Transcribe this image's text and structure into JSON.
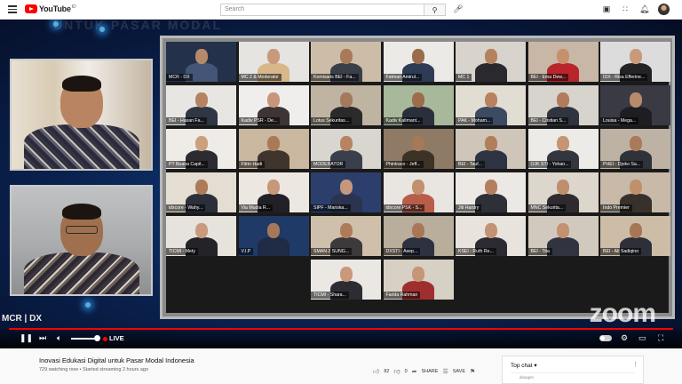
{
  "header": {
    "logo_text": "YouTube",
    "logo_sup": "ID",
    "search_placeholder": "Search",
    "icons": [
      "menu-icon",
      "search-icon",
      "mic-icon",
      "create-video-icon",
      "apps-icon",
      "notifications-icon",
      "account-avatar"
    ]
  },
  "player": {
    "background_title": "UNTUK PASAR MODAL",
    "speakers": [
      {
        "name": "speaker-top"
      },
      {
        "name": "speaker-bottom"
      }
    ],
    "participants": [
      {
        "label": "MCR - DX",
        "bg": "#23314a",
        "skin": "#b48a6a",
        "cloth": "#445577",
        "active": true
      },
      {
        "label": "MC 2 & Moderator",
        "bg": "#e6e4e0",
        "skin": "#c79a7c",
        "cloth": "#d8b88a",
        "active": false
      },
      {
        "label": "Komisaris BEI - Fa...",
        "bg": "#cdbca8",
        "skin": "#a97a5a",
        "cloth": "#3b3f4a",
        "active": false
      },
      {
        "label": "Fatman Amirul...",
        "bg": "#eceae6",
        "skin": "#9a6c4a",
        "cloth": "#2d3b55",
        "active": false
      },
      {
        "label": "MC 1",
        "bg": "#d8d3cc",
        "skin": "#b3825f",
        "cloth": "#2a2a2e",
        "active": false
      },
      {
        "label": "BEI - Ema Dew...",
        "bg": "#c8b7a6",
        "skin": "#c6906c",
        "cloth": "#b8252b",
        "active": false
      },
      {
        "label": "IDX - Risa Efferine...",
        "bg": "#dcdcdc",
        "skin": "#c99a7a",
        "cloth": "#222227",
        "active": false
      },
      {
        "label": "BEI - Hasan Fa...",
        "bg": "#e8e6e2",
        "skin": "#b48462",
        "cloth": "#2f3644",
        "active": false
      },
      {
        "label": "Kadiv PSR - De...",
        "bg": "#f0eeec",
        "skin": "#c7967a",
        "cloth": "#3d3434",
        "active": false
      },
      {
        "label": "Lotus Sekuritas...",
        "bg": "#bfb3a2",
        "skin": "#a47a5c",
        "cloth": "#2a2a2a",
        "active": false
      },
      {
        "label": "Kadiv Kalimant...",
        "bg": "#a8b89a",
        "skin": "#9c6c4c",
        "cloth": "#2b2f3c",
        "active": false
      },
      {
        "label": "PAK - Moham...",
        "bg": "#e2ddd2",
        "skin": "#b8825e",
        "cloth": "#3c4a62",
        "active": false
      },
      {
        "label": "BEI - Cristian S...",
        "bg": "#d7d4ce",
        "skin": "#b07c5c",
        "cloth": "#30343e",
        "active": false
      },
      {
        "label": "Louisa - Mega...",
        "bg": "#3a3a44",
        "skin": "#b88a6c",
        "cloth": "#1e1e22",
        "active": false
      },
      {
        "label": "PT Buana Capit...",
        "bg": "#efece8",
        "skin": "#caa07e",
        "cloth": "#2c2c30",
        "active": false
      },
      {
        "label": "Fitrin Hadi",
        "bg": "#c9b7a0",
        "skin": "#a97a58",
        "cloth": "#40352c",
        "active": false
      },
      {
        "label": "MODERATOR",
        "bg": "#d9d6d0",
        "skin": "#b68462",
        "cloth": "#3a3f4c",
        "active": false
      },
      {
        "label": "Phintraco - Jeff...",
        "bg": "#8f7a66",
        "skin": "#a77858",
        "cloth": "#3c3226",
        "active": false
      },
      {
        "label": "BEI - Tauf...",
        "bg": "#cfc5b8",
        "skin": "#b17e5c",
        "cloth": "#2d3342",
        "active": false
      },
      {
        "label": "OJK STI - Yohan...",
        "bg": "#ecebe8",
        "skin": "#c59574",
        "cloth": "#33363e",
        "active": false
      },
      {
        "label": "PHEI - Djoko Sa...",
        "bg": "#bdb2a4",
        "skin": "#a97b5b",
        "cloth": "#30323a",
        "active": false
      },
      {
        "label": "idxcore - Wahy...",
        "bg": "#e4ddd2",
        "skin": "#ad7b59",
        "cloth": "#2a2f3a",
        "active": false
      },
      {
        "label": "Via Mudia R...",
        "bg": "#ede7e2",
        "skin": "#c7977a",
        "cloth": "#202026",
        "active": false
      },
      {
        "label": "SIPF - Mariska...",
        "bg": "#2c3f6c",
        "skin": "#c5987c",
        "cloth": "#2b3350",
        "active": false
      },
      {
        "label": "idxcore PSK - S...",
        "bg": "#e9e6e1",
        "skin": "#c3906f",
        "cloth": "#b95d4b",
        "active": false
      },
      {
        "label": "Jiti Hardry",
        "bg": "#ece9e4",
        "skin": "#b47f5e",
        "cloth": "#2e3038",
        "active": false
      },
      {
        "label": "MNC Sekurita...",
        "bg": "#dcd6cc",
        "skin": "#bf8f6d",
        "cloth": "#2e2b30",
        "active": false
      },
      {
        "label": "Indo Premier",
        "bg": "#c8b9a8",
        "skin": "#c0906c",
        "cloth": "#37312c",
        "active": false
      },
      {
        "label": "TICMI - Mety",
        "bg": "#e6e2dc",
        "skin": "#c89a7e",
        "cloth": "#242428",
        "active": false
      },
      {
        "label": "V.I.P",
        "bg": "#1f3a66",
        "skin": "#a67858",
        "cloth": "#1f2a44",
        "active": false
      },
      {
        "label": "SMAN 2 SUNG...",
        "bg": "#cfc0ac",
        "skin": "#ae7c5a",
        "cloth": "#3c3a3a",
        "active": false
      },
      {
        "label": "DXSTI - Asep...",
        "bg": "#b9ad9c",
        "skin": "#a97656",
        "cloth": "#2c3240",
        "active": false
      },
      {
        "label": "KSEI - Ruth Re...",
        "bg": "#e8e3dc",
        "skin": "#c39274",
        "cloth": "#2a2a30",
        "active": false
      },
      {
        "label": "BEI - Tita",
        "bg": "#d2c9be",
        "skin": "#c2916f",
        "cloth": "#313340",
        "active": false
      },
      {
        "label": "BEI - Ali Sadiqino",
        "bg": "#cdbda6",
        "skin": "#a67656",
        "cloth": "#2d3038",
        "active": false
      },
      {
        "label": "TICMI - Shara...",
        "bg": "#ebe8e4",
        "skin": "#c8997b",
        "cloth": "#2c2c32",
        "active": false
      },
      {
        "label": "Farida Rahman",
        "bg": "#d7d0c4",
        "skin": "#c59678",
        "cloth": "#9f2f2f",
        "active": false
      }
    ],
    "zoom_logo": "zoom",
    "channel_logo": "MCR | DX",
    "live_label": "LIVE"
  },
  "video": {
    "title": "Inovasi Edukasi Digital untuk Pasar Modal Indonesia",
    "meta": "729 watching now • Started streaming 2 hours ago",
    "likes": "82",
    "dislikes": "0",
    "share_label": "SHARE",
    "save_label": "SAVE"
  },
  "chat": {
    "header": "Top chat ▾",
    "line": "dinegeri"
  }
}
